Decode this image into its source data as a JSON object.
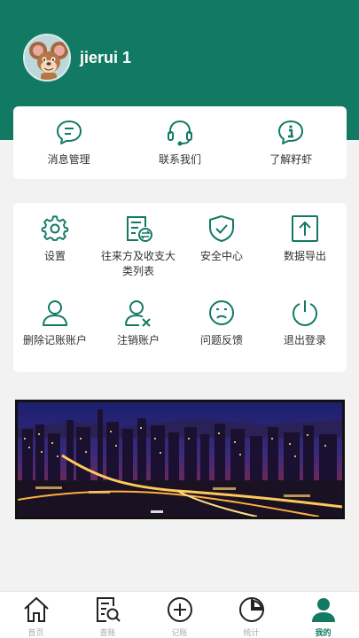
{
  "profile": {
    "username": "jierui 1"
  },
  "top_menu": [
    {
      "label": "消息管理",
      "icon": "message-icon"
    },
    {
      "label": "联系我们",
      "icon": "headset-icon"
    },
    {
      "label": "了解籽虾",
      "icon": "info-icon"
    }
  ],
  "grid_menu": [
    {
      "label": "设置",
      "icon": "gear-icon"
    },
    {
      "label": "往来方及收支大类列表",
      "icon": "document-exchange-icon"
    },
    {
      "label": "安全中心",
      "icon": "shield-check-icon"
    },
    {
      "label": "数据导出",
      "icon": "upload-icon"
    },
    {
      "label": "删除记账账户",
      "icon": "user-icon"
    },
    {
      "label": "注销账户",
      "icon": "user-remove-icon"
    },
    {
      "label": "问题反馈",
      "icon": "sad-face-icon"
    },
    {
      "label": "退出登录",
      "icon": "power-icon"
    }
  ],
  "bottom_nav": [
    {
      "label": "首页",
      "icon": "home-icon"
    },
    {
      "label": "查账",
      "icon": "search-document-icon"
    },
    {
      "label": "记账",
      "icon": "plus-circle-icon"
    },
    {
      "label": "统计",
      "icon": "pie-chart-icon"
    },
    {
      "label": "我的",
      "icon": "profile-icon",
      "active": true
    }
  ],
  "colors": {
    "brand": "#127a63",
    "active_nav": "#127a63",
    "inactive_nav": "#aaaaaa"
  }
}
